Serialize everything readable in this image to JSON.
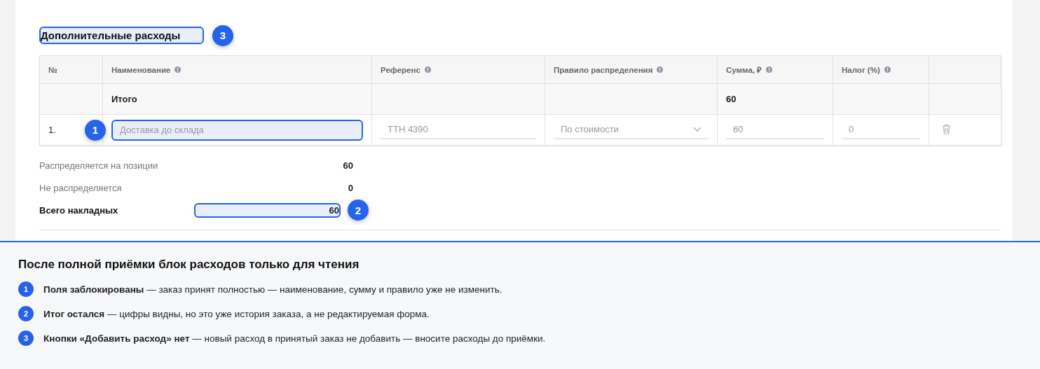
{
  "section": {
    "title": "Дополнительные расходы",
    "badge": "3"
  },
  "table": {
    "columns": [
      {
        "label": "№",
        "info": false
      },
      {
        "label": "Наименование",
        "info": true
      },
      {
        "label": "Референс",
        "info": true
      },
      {
        "label": "Правило распределения",
        "info": true
      },
      {
        "label": "Сумма, ₽",
        "info": true
      },
      {
        "label": "Налог (%)",
        "info": true
      }
    ],
    "total_row": {
      "label": "Итого",
      "sum": "60"
    },
    "rows": [
      {
        "number": "1.",
        "name": {
          "value": "Доставка до склада",
          "disabled": true,
          "badge": "1"
        },
        "reference": {
          "value": "ТТН 4390",
          "disabled": true
        },
        "rule": {
          "value": "По стоимости",
          "disabled": true
        },
        "sum": {
          "value": "60",
          "disabled": true
        },
        "tax": {
          "value": "0",
          "disabled": true
        }
      }
    ]
  },
  "summary": [
    {
      "label": "Распределяется на позиции",
      "value": "60",
      "bold": false
    },
    {
      "label": "Не распределяется",
      "value": "0",
      "bold": false
    },
    {
      "label": "Всего накладных",
      "value": "60",
      "bold": true,
      "badge": "2"
    }
  ],
  "notes": {
    "title": "После полной приёмки блок расходов только для чтения",
    "items": [
      {
        "number": "1",
        "text": "**Поля заблокированы** — заказ принят полностью — наименование, сумму и правило уже не изменить."
      },
      {
        "number": "2",
        "text": "**Итог остался** — цифры видны, но это уже история заказа, а не редактируемая форма."
      },
      {
        "number": "3",
        "text": "**Кнопки «Добавить расход» нет** — новый расход в принятый заказ не добавить — вносите расходы до приёмки."
      }
    ]
  }
}
